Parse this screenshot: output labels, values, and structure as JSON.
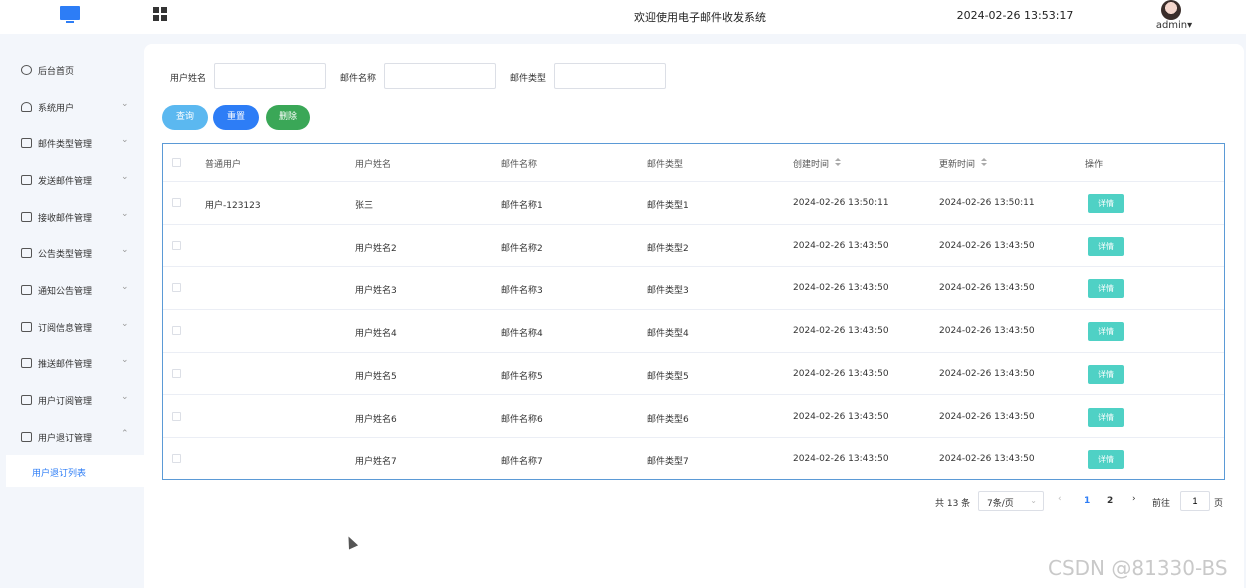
{
  "header": {
    "title": "欢迎使用电子邮件收发系统",
    "datetime": "2024-02-26 13:53:17",
    "username": "admin",
    "username_caret": "▾"
  },
  "sidebar": {
    "items": [
      {
        "label": "后台首页",
        "icon": "dashboard-icon",
        "chevron": ""
      },
      {
        "label": "系统用户",
        "icon": "user-icon",
        "chevron": "⌄"
      },
      {
        "label": "邮件类型管理",
        "icon": "list-icon",
        "chevron": "⌄"
      },
      {
        "label": "发送邮件管理",
        "icon": "list-icon",
        "chevron": "⌄"
      },
      {
        "label": "接收邮件管理",
        "icon": "list-icon",
        "chevron": "⌄"
      },
      {
        "label": "公告类型管理",
        "icon": "list-icon",
        "chevron": "⌄"
      },
      {
        "label": "通知公告管理",
        "icon": "list-icon",
        "chevron": "⌄"
      },
      {
        "label": "订阅信息管理",
        "icon": "list-icon",
        "chevron": "⌄"
      },
      {
        "label": "推送邮件管理",
        "icon": "list-icon",
        "chevron": "⌄"
      },
      {
        "label": "用户订阅管理",
        "icon": "list-icon",
        "chevron": "⌄"
      },
      {
        "label": "用户退订管理",
        "icon": "list-icon",
        "chevron": "⌃"
      }
    ],
    "active_subitem": "用户退订列表"
  },
  "filters": {
    "user_name_label": "用户姓名",
    "user_name_value": "",
    "mail_name_label": "邮件名称",
    "mail_name_value": "",
    "mail_type_label": "邮件类型",
    "mail_type_value": ""
  },
  "actions": {
    "query": "查询",
    "reset": "重置",
    "delete": "删除",
    "colors": {
      "query": "#5bb8f0",
      "reset": "#2d7df6",
      "delete": "#3aa757"
    }
  },
  "table": {
    "headers": [
      "普通用户",
      "用户姓名",
      "邮件名称",
      "邮件类型",
      "创建时间",
      "更新时间",
      "操作"
    ],
    "detail_label": "详情",
    "rows": [
      {
        "user": "用户-123123",
        "name": "张三",
        "mail_name": "邮件名称1",
        "mail_type": "邮件类型1",
        "created": "2024-02-26 13:50:11",
        "updated": "2024-02-26 13:50:11"
      },
      {
        "user": "",
        "name": "用户姓名2",
        "mail_name": "邮件名称2",
        "mail_type": "邮件类型2",
        "created": "2024-02-26 13:43:50",
        "updated": "2024-02-26 13:43:50"
      },
      {
        "user": "",
        "name": "用户姓名3",
        "mail_name": "邮件名称3",
        "mail_type": "邮件类型3",
        "created": "2024-02-26 13:43:50",
        "updated": "2024-02-26 13:43:50"
      },
      {
        "user": "",
        "name": "用户姓名4",
        "mail_name": "邮件名称4",
        "mail_type": "邮件类型4",
        "created": "2024-02-26 13:43:50",
        "updated": "2024-02-26 13:43:50"
      },
      {
        "user": "",
        "name": "用户姓名5",
        "mail_name": "邮件名称5",
        "mail_type": "邮件类型5",
        "created": "2024-02-26 13:43:50",
        "updated": "2024-02-26 13:43:50"
      },
      {
        "user": "",
        "name": "用户姓名6",
        "mail_name": "邮件名称6",
        "mail_type": "邮件类型6",
        "created": "2024-02-26 13:43:50",
        "updated": "2024-02-26 13:43:50"
      },
      {
        "user": "",
        "name": "用户姓名7",
        "mail_name": "邮件名称7",
        "mail_type": "邮件类型7",
        "created": "2024-02-26 13:43:50",
        "updated": "2024-02-26 13:43:50"
      }
    ]
  },
  "pagination": {
    "total": "共 13 条",
    "page_size": "7条/页",
    "prev": "‹",
    "pages": [
      "1",
      "2"
    ],
    "current_page": "1",
    "next": "›",
    "goto_label": "前往",
    "goto_value": "1",
    "page_suffix": "页"
  },
  "watermark": "CSDN @81330-BS"
}
